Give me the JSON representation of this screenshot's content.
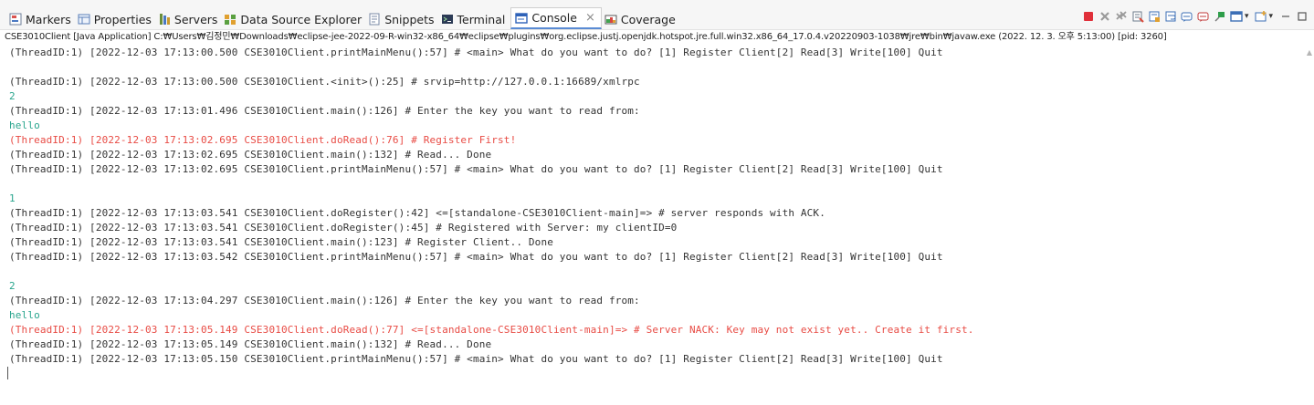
{
  "tabs": [
    {
      "label": "Markers",
      "icon": "markers-icon",
      "active": false
    },
    {
      "label": "Properties",
      "icon": "properties-icon",
      "active": false
    },
    {
      "label": "Servers",
      "icon": "servers-icon",
      "active": false
    },
    {
      "label": "Data Source Explorer",
      "icon": "data-source-explorer-icon",
      "active": false
    },
    {
      "label": "Snippets",
      "icon": "snippets-icon",
      "active": false
    },
    {
      "label": "Terminal",
      "icon": "terminal-icon",
      "active": false
    },
    {
      "label": "Console",
      "icon": "console-icon",
      "active": true,
      "close": "×"
    },
    {
      "label": "Coverage",
      "icon": "coverage-icon",
      "active": false
    }
  ],
  "toolbar": [
    {
      "icon": "terminate-icon",
      "color": "#e0303a"
    },
    {
      "icon": "remove-launch-icon",
      "color": "#9a9a9a"
    },
    {
      "icon": "remove-all-terminated-icon",
      "color": "#9a9a9a"
    },
    {
      "icon": "clear-console-icon",
      "color": "#6b7a8a"
    },
    {
      "icon": "scroll-lock-icon",
      "color": "#3c6fb6"
    },
    {
      "icon": "word-wrap-icon",
      "color": "#3c6fb6"
    },
    {
      "icon": "show-stdout-icon",
      "color": "#3c6fb6"
    },
    {
      "icon": "show-stderr-icon",
      "color": "#c23b3b"
    },
    {
      "icon": "pin-console-icon",
      "color": "#2e9e4a"
    },
    {
      "icon": "display-selected-console-icon",
      "color": "#3c6fb6",
      "dropdown": true
    },
    {
      "icon": "open-console-icon",
      "color": "#3c6fb6",
      "dropdown": true
    },
    {
      "icon": "minimize-icon",
      "color": "#555555"
    },
    {
      "icon": "maximize-icon",
      "color": "#555555"
    }
  ],
  "status": "CSE3010Client [Java Application] C:₩Users₩김정민₩Downloads₩eclipse-jee-2022-09-R-win32-x86_64₩eclipse₩plugins₩org.eclipse.justj.openjdk.hotspot.jre.full.win32.x86_64_17.0.4.v20220903-1038₩jre₩bin₩javaw.exe  (2022. 12. 3. 오후 5:13:00) [pid: 3260]",
  "colors": {
    "stdout": "#333333",
    "stdin": "#29a58d",
    "stderr": "#e84b44",
    "active_tab_accent": "#5a8bd4"
  },
  "console": [
    {
      "type": "out",
      "text": "(ThreadID:1) [2022-12-03 17:13:00.500 CSE3010Client.printMainMenu():57] # <main> What do you want to do? [1] Register Client[2] Read[3] Write[100] Quit"
    },
    {
      "type": "out",
      "text": ""
    },
    {
      "type": "out",
      "text": "(ThreadID:1) [2022-12-03 17:13:00.500 CSE3010Client.<init>():25] # srvip=http://127.0.0.1:16689/xmlrpc"
    },
    {
      "type": "in",
      "text": "2"
    },
    {
      "type": "out",
      "text": "(ThreadID:1) [2022-12-03 17:13:01.496 CSE3010Client.main():126] # Enter the key you want to read from:"
    },
    {
      "type": "in",
      "text": "hello"
    },
    {
      "type": "err",
      "text": "(ThreadID:1) [2022-12-03 17:13:02.695 CSE3010Client.doRead():76] # Register First!"
    },
    {
      "type": "out",
      "text": "(ThreadID:1) [2022-12-03 17:13:02.695 CSE3010Client.main():132] # Read... Done"
    },
    {
      "type": "out",
      "text": "(ThreadID:1) [2022-12-03 17:13:02.695 CSE3010Client.printMainMenu():57] # <main> What do you want to do? [1] Register Client[2] Read[3] Write[100] Quit"
    },
    {
      "type": "out",
      "text": ""
    },
    {
      "type": "in",
      "text": "1"
    },
    {
      "type": "out",
      "text": "(ThreadID:1) [2022-12-03 17:13:03.541 CSE3010Client.doRegister():42] <=[standalone-CSE3010Client-main]=> # server responds with ACK."
    },
    {
      "type": "out",
      "text": "(ThreadID:1) [2022-12-03 17:13:03.541 CSE3010Client.doRegister():45] # Registered with Server: my clientID=0"
    },
    {
      "type": "out",
      "text": "(ThreadID:1) [2022-12-03 17:13:03.541 CSE3010Client.main():123] # Register Client.. Done"
    },
    {
      "type": "out",
      "text": "(ThreadID:1) [2022-12-03 17:13:03.542 CSE3010Client.printMainMenu():57] # <main> What do you want to do? [1] Register Client[2] Read[3] Write[100] Quit"
    },
    {
      "type": "out",
      "text": ""
    },
    {
      "type": "in",
      "text": "2"
    },
    {
      "type": "out",
      "text": "(ThreadID:1) [2022-12-03 17:13:04.297 CSE3010Client.main():126] # Enter the key you want to read from:"
    },
    {
      "type": "in",
      "text": "hello"
    },
    {
      "type": "err",
      "text": "(ThreadID:1) [2022-12-03 17:13:05.149 CSE3010Client.doRead():77] <=[standalone-CSE3010Client-main]=> # Server NACK: Key may not exist yet.. Create it first."
    },
    {
      "type": "out",
      "text": "(ThreadID:1) [2022-12-03 17:13:05.149 CSE3010Client.main():132] # Read... Done"
    },
    {
      "type": "out",
      "text": "(ThreadID:1) [2022-12-03 17:13:05.150 CSE3010Client.printMainMenu():57] # <main> What do you want to do? [1] Register Client[2] Read[3] Write[100] Quit"
    }
  ]
}
